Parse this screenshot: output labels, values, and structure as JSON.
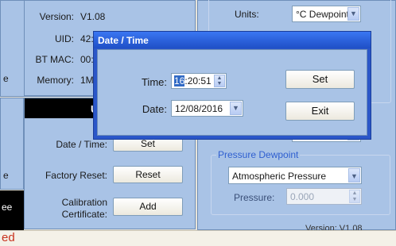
{
  "left_panel": {
    "version_label": "Version:",
    "version_value": "V1.08",
    "uid_label": "UID:",
    "uid_value": "42:",
    "btmac_label": "BT MAC:",
    "btmac_value": "00:",
    "memory_label": "Memory:",
    "memory_value": "1M",
    "section_header_fragment": "U",
    "date_time_label": "Date / Time:",
    "set_button": "Set",
    "factory_reset_label": "Factory Reset:",
    "reset_button": "Reset",
    "calibration_label_line1": "Calibration",
    "calibration_label_line2": "Certificate:",
    "add_button": "Add",
    "edge_fragments": [
      "e",
      "e",
      "ee"
    ]
  },
  "right_panel": {
    "units_label": "Units:",
    "units_value": "°C Dewpoint",
    "pressure_group_title": "Pressure Dewpoint",
    "pressure_mode_value": "Atmospheric Pressure",
    "pressure_label": "Pressure:",
    "pressure_value": "0.000",
    "bottom_version_fragment": "Version:   V1.08"
  },
  "status_bar": {
    "text_fragment": "ed"
  },
  "dialog": {
    "title": "Date / Time",
    "time_label": "Time:",
    "time_hours_selected": "16",
    "time_rest": ":20:51",
    "date_label": "Date:",
    "date_value": "12/08/2016",
    "set_button": "Set",
    "exit_button": "Exit"
  },
  "colors": {
    "panel_blue": "#a9c3e6",
    "title_blue": "#2a56c8",
    "accent_text_blue": "#2f5fd0",
    "status_red": "#c8321e"
  }
}
